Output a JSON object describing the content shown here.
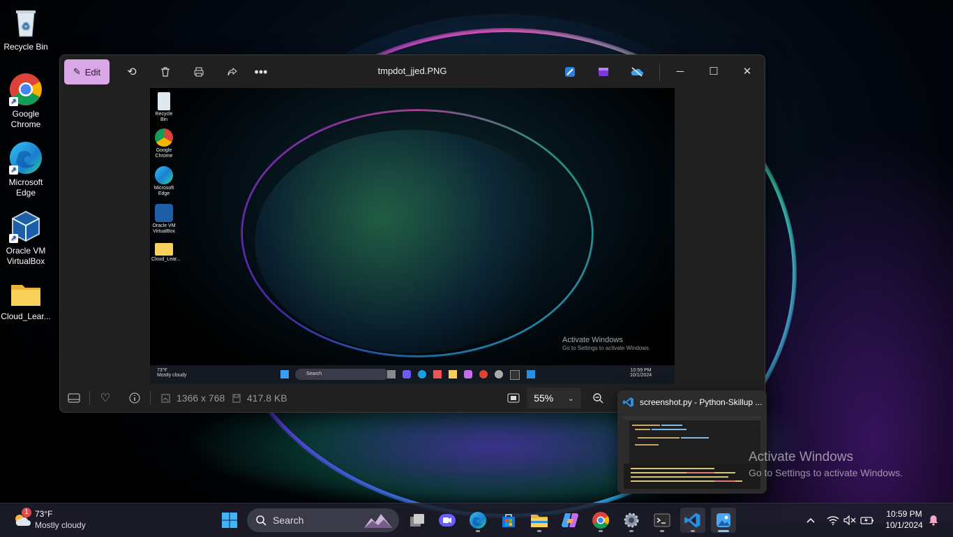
{
  "desktop": {
    "icons": [
      {
        "label": "Recycle Bin",
        "icon": "recycle-bin-icon"
      },
      {
        "label": "Google Chrome",
        "icon": "chrome-icon"
      },
      {
        "label": "Microsoft Edge",
        "icon": "edge-icon"
      },
      {
        "label": "Oracle VM VirtualBox",
        "icon": "virtualbox-icon"
      },
      {
        "label": "Cloud_Lear...",
        "icon": "folder-icon"
      }
    ],
    "activate_title": "Activate Windows",
    "activate_sub": "Go to Settings to activate Windows."
  },
  "photos": {
    "edit_label": "Edit",
    "title": "tmpdot_jjed.PNG",
    "dimensions": "1366 x 768",
    "file_size": "417.8 KB",
    "zoom": "55%",
    "preview": {
      "icons": [
        "Recycle Bin",
        "Google Chrome",
        "Microsoft Edge",
        "Oracle VM VirtualBox",
        "Cloud_Lear..."
      ],
      "activate_title": "Activate Windows",
      "activate_sub": "Go to Settings to activate Windows.",
      "weather_temp": "73°F",
      "weather_desc": "Mostly cloudy",
      "search": "Search",
      "time": "10:59 PM",
      "date": "10/1/2024"
    }
  },
  "thumbnail": {
    "title": "screenshot.py - Python-Skillup ..."
  },
  "taskbar": {
    "weather_badge": "1",
    "weather_temp": "73°F",
    "weather_desc": "Mostly cloudy",
    "search_placeholder": "Search",
    "time": "10:59 PM",
    "date": "10/1/2024",
    "apps": [
      "start",
      "task-view",
      "meet",
      "edge",
      "store",
      "file-explorer",
      "copilot",
      "chrome",
      "settings",
      "terminal",
      "vscode",
      "photos"
    ]
  },
  "colors": {
    "edit_accent": "#d9a6e6",
    "vscode_blue": "#2a8fe0",
    "taskbar_bg": "#1e1e2d"
  }
}
